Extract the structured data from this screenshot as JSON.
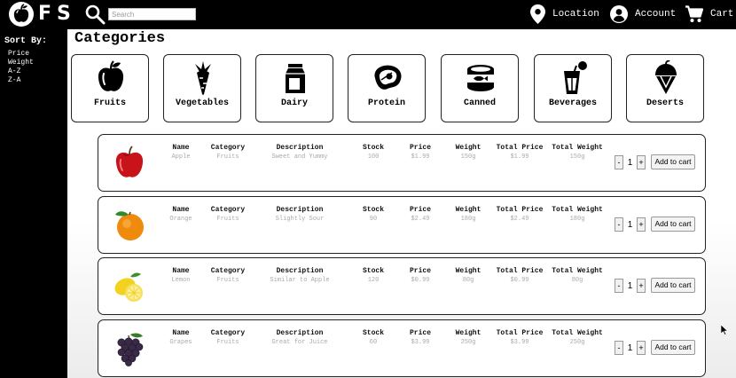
{
  "brand": {
    "name": "FS",
    "logo_icon": "apple-logo-icon"
  },
  "search": {
    "placeholder": "Search",
    "value": ""
  },
  "nav": {
    "location": {
      "label": "Location",
      "icon": "location-pin-icon"
    },
    "account": {
      "label": "Account",
      "icon": "account-icon"
    },
    "cart": {
      "label": "Cart",
      "icon": "cart-icon"
    }
  },
  "sidebar": {
    "title": "Sort By:",
    "options": [
      "Price",
      "Weight",
      "A-Z",
      "Z-A"
    ]
  },
  "categories": {
    "title": "Categories",
    "items": [
      {
        "label": "Fruits",
        "icon": "apple-icon"
      },
      {
        "label": "Vegetables",
        "icon": "carrot-icon"
      },
      {
        "label": "Dairy",
        "icon": "milk-carton-icon"
      },
      {
        "label": "Protein",
        "icon": "steak-icon"
      },
      {
        "label": "Canned",
        "icon": "canned-fish-icon"
      },
      {
        "label": "Beverages",
        "icon": "drink-cup-icon"
      },
      {
        "label": "Deserts",
        "icon": "ice-cream-icon"
      }
    ]
  },
  "product_columns": {
    "name": "Name",
    "category": "Category",
    "description": "Description",
    "stock": "Stock",
    "price": "Price",
    "weight": "Weight",
    "total_price": "Total Price",
    "total_weight": "Total Weight"
  },
  "products": [
    {
      "name": "Apple",
      "category": "Fruits",
      "description": "Sweet and Yummy",
      "stock": "100",
      "price": "$1.99",
      "weight": "150g",
      "total_price": "$1.99",
      "total_weight": "150g",
      "quantity": "1",
      "image": "red-apple-image"
    },
    {
      "name": "Orange",
      "category": "Fruits",
      "description": "Slightly Sour",
      "stock": "90",
      "price": "$2.49",
      "weight": "180g",
      "total_price": "$2.49",
      "total_weight": "180g",
      "quantity": "1",
      "image": "orange-image"
    },
    {
      "name": "Lemon",
      "category": "Fruits",
      "description": "Similar to Apple",
      "stock": "120",
      "price": "$0.99",
      "weight": "80g",
      "total_price": "$0.99",
      "total_weight": "80g",
      "quantity": "1",
      "image": "lemon-image"
    },
    {
      "name": "Grapes",
      "category": "Fruits",
      "description": "Great for Juice",
      "stock": "60",
      "price": "$3.99",
      "weight": "250g",
      "total_price": "$3.99",
      "total_weight": "250g",
      "quantity": "1",
      "image": "grapes-image"
    }
  ],
  "controls": {
    "minus": "-",
    "plus": "+",
    "add_to_cart": "Add to cart"
  },
  "colors": {
    "header_bg": "#000000",
    "sidebar_bg": "#000000",
    "panel_bg": "#ffffff",
    "value_text": "#aaaaaa"
  }
}
